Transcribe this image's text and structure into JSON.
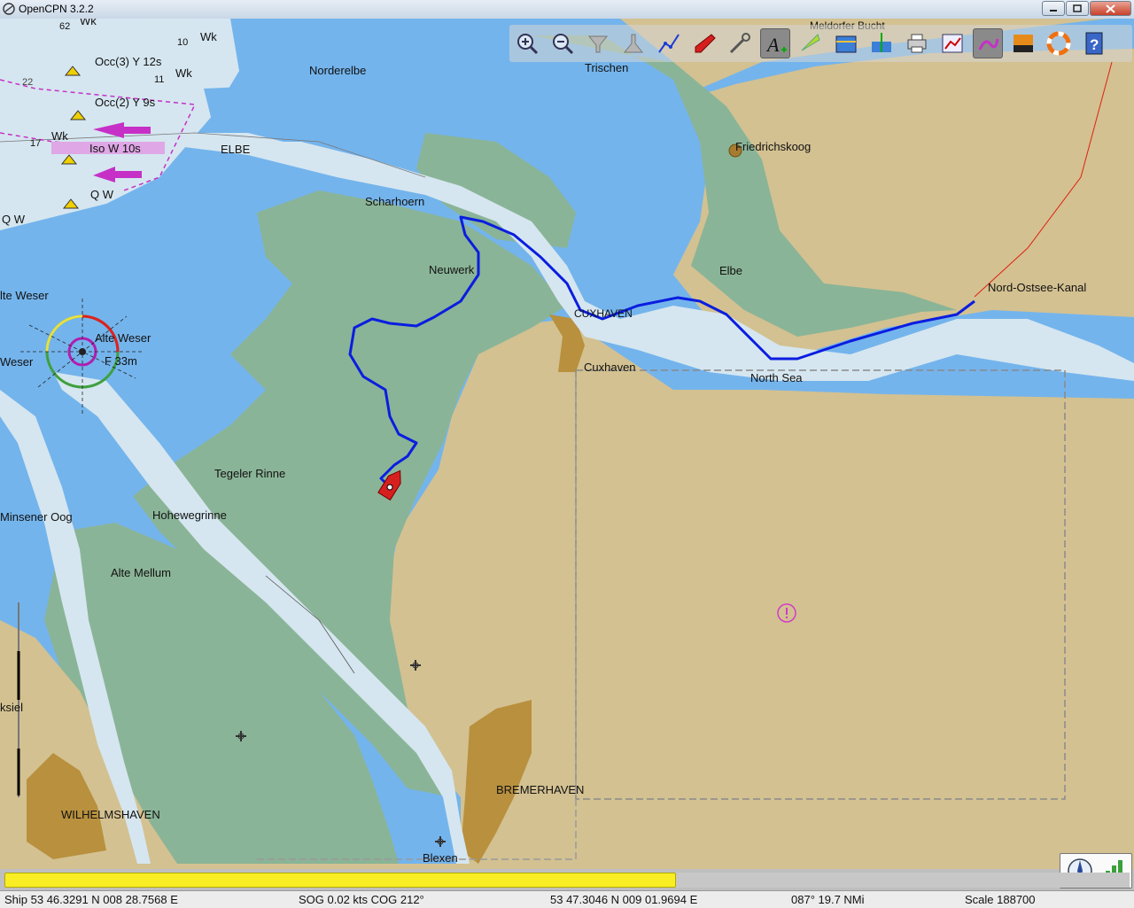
{
  "window": {
    "title": "OpenCPN 3.2.2"
  },
  "toolbar": {
    "buttons": [
      {
        "id": "zoom-in",
        "icon": "zoom-in-icon"
      },
      {
        "id": "zoom-out",
        "icon": "zoom-out-icon"
      },
      {
        "id": "scale-in",
        "icon": "funnel-down-icon"
      },
      {
        "id": "scale-out",
        "icon": "funnel-up-icon"
      },
      {
        "id": "route",
        "icon": "route-icon"
      },
      {
        "id": "follow",
        "icon": "ship-icon"
      },
      {
        "id": "settings",
        "icon": "wrench-icon"
      },
      {
        "id": "text",
        "icon": "text-icon"
      },
      {
        "id": "current",
        "icon": "current-icon"
      },
      {
        "id": "tide",
        "icon": "tide-icon"
      },
      {
        "id": "tide-height",
        "icon": "tide-height-icon"
      },
      {
        "id": "print",
        "icon": "printer-icon"
      },
      {
        "id": "route-manager",
        "icon": "route-manager-icon"
      },
      {
        "id": "track",
        "icon": "track-icon"
      },
      {
        "id": "color-scheme",
        "icon": "sunset-icon"
      },
      {
        "id": "mob",
        "icon": "lifebuoy-icon"
      },
      {
        "id": "help",
        "icon": "help-icon"
      }
    ],
    "active_button": "track"
  },
  "chart": {
    "labels": {
      "wk1": "Wk",
      "wk2": "Wk",
      "wk3": "Wk",
      "wk4": "Wk",
      "light1": "Occ(3) Y 12s",
      "light2": "Occ(2) Y 9s",
      "light3": "Iso W 10s",
      "light4": "Q W",
      "light5": "Q W",
      "depth22": "22",
      "depth108": "10",
      "depth114": "11",
      "depth178": "17",
      "depth62": "62",
      "norderelbe": "Norderelbe",
      "trischen": "Trischen",
      "elbe_upper": "ELBE",
      "friedrichskoog": "Friedrichskoog",
      "scharhoern": "Scharhoern",
      "neuwerk": "Neuwerk",
      "elbe": "Elbe",
      "nok": "Nord-Ostsee-Kanal",
      "cuxhaven_caps": "CUXHAVEN",
      "cuxhaven": "Cuxhaven",
      "north_sea": "North Sea",
      "alte_weser_left": "lte Weser",
      "alte_weser": "Alte Weser",
      "weser": "Weser",
      "f33m": "F 33m",
      "tegeler": "Tegeler Rinne",
      "hohewegrinne": "Hohewegrinne",
      "minsener": "Minsener Oog",
      "alte_mellum": "Alte Mellum",
      "bremerhaven": "BREMERHAVEN",
      "wilhelmshaven": "WILHELMSHAVEN",
      "blexen": "Blexen",
      "ksiel": "ksiel",
      "meldorfer": "Meldorfer Bucht"
    },
    "colors": {
      "deep": "#74b4ec",
      "shallow": "#d5e6f0",
      "land": "#d3c191",
      "intertidal": "#8ab497",
      "track": "#0a1de0",
      "urban": "#b8903e"
    }
  },
  "progress": {
    "fraction": 0.597
  },
  "status": {
    "ship": "Ship 53 46.3291 N   008 28.7568 E",
    "sog": "SOG 0.02 kts   COG 212°",
    "cursor": "53 47.3046 N   009 01.9694 E",
    "bearing": "087°  19.7 NMi",
    "scale": "Scale 188700"
  }
}
